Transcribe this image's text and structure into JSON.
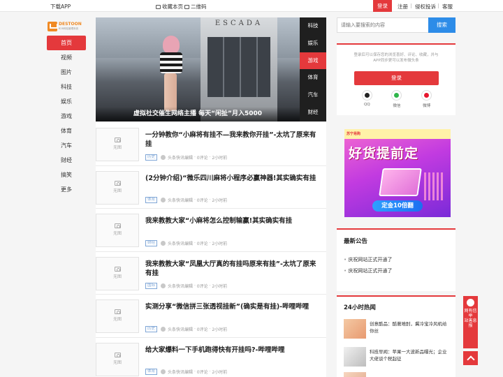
{
  "topbar": {
    "download": "下载APP",
    "favorite": "收藏本页",
    "qrcode": "二维码",
    "login": "登录",
    "register": "注册",
    "complaint": "侵权投诉",
    "service": "客服"
  },
  "logo": {
    "name": "DESTOON",
    "tagline": "B2B网站管理系统"
  },
  "nav": [
    "首页",
    "视频",
    "图片",
    "科技",
    "娱乐",
    "游戏",
    "体育",
    "汽车",
    "财经",
    "搞笑",
    "更多"
  ],
  "banner": {
    "store_sign": "ESCADA",
    "caption": "虚拟社交催生网络主播 每天“闲扯”月入5000",
    "tabs": [
      "科技",
      "娱乐",
      "游戏",
      "体育",
      "汽车",
      "财经"
    ],
    "active_tab": "游戏"
  },
  "articles": [
    {
      "title": "一分钟教你“小麻将有挂不—我来教你开挂”-太坑了原来有挂",
      "tag": "历史",
      "author": "头条快讯编辑",
      "comments": "0评论",
      "time": "2小时前",
      "thumb": "无图"
    },
    {
      "title": "(2分钟介绍)“微乐四川麻将小程序必赢神器!其实确实有挂",
      "tag": "体育",
      "author": "头条快讯编辑",
      "comments": "0评论",
      "time": "2小时前",
      "thumb": "无图"
    },
    {
      "title": "我来教教大家“小麻将怎么控制输赢!其实确实有挂",
      "tag": "财经",
      "author": "头条快讯编辑",
      "comments": "0评论",
      "time": "2小时前",
      "thumb": "无图"
    },
    {
      "title": "我来教教大家“凤凰大厅真的有挂吗原来有挂”-太坑了原来有挂",
      "tag": "国际",
      "author": "头条快讯编辑",
      "comments": "0评论",
      "time": "2小时前",
      "thumb": "无图"
    },
    {
      "title": "实测分享“微信拼三张透视挂新”(确实是有挂)-哔哩哔哩",
      "tag": "历史",
      "author": "头条快讯编辑",
      "comments": "0评论",
      "time": "2小时前",
      "thumb": "无图"
    },
    {
      "title": "给大家爆料一下手机跑得快有开挂吗?-哔哩哔哩",
      "tag": "体育",
      "author": "头条快讯编辑",
      "comments": "0评论",
      "time": "2小时前",
      "thumb": "无图"
    }
  ],
  "search": {
    "placeholder": "请输入要搜索的内容",
    "button": "搜索"
  },
  "loginbox": {
    "tip": "登录后可以保存您的浏览喜好、评论、收藏，并与APP同步更可以发布微头条",
    "button": "登录",
    "social": [
      "QQ",
      "微信",
      "微博"
    ]
  },
  "ad": {
    "brand": "苏宁易购",
    "headline": "好货提前定",
    "pill": "定金10倍翻"
  },
  "notice": {
    "title": "最新公告",
    "items": [
      "庆祝网站正式开通了",
      "庆祝网站正式开通了"
    ]
  },
  "hot": {
    "title": "24小时热闻",
    "items": [
      "创意酷品：酷著难酎，冀冷宝冷风机给你丝",
      "科技早闻：苹果一大波新品曝光；企业大佬谈个税起征"
    ]
  },
  "float": {
    "feedback": "网有信举\n站害息报",
    "top": ""
  },
  "colors": {
    "accent": "#e4393c",
    "blue": "#2d8ce8",
    "tag": "#7fa6d6"
  }
}
